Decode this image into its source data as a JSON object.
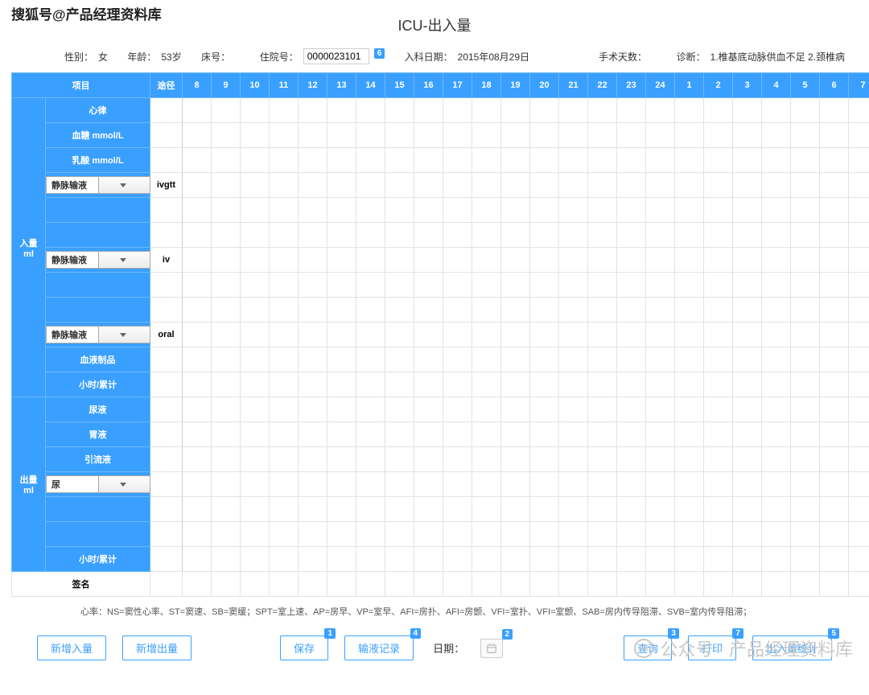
{
  "watermarks": {
    "top": "搜狐号@产品经理资料库",
    "bottom": "公众号 · 产品经理资料库"
  },
  "title": "ICU-出入量",
  "info": {
    "sex_label": "性别：",
    "sex_value": "女",
    "age_label": "年龄：",
    "age_value": "53岁",
    "bed_label": "床号：",
    "adm_label": "住院号：",
    "adm_value": "0000023101",
    "adm_badge": "6",
    "indate_label": "入科日期：",
    "indate_value": "2015年08月29日",
    "surgdays_label": "手术天数：",
    "diag_label": "诊断：",
    "diag_value": "1.椎基底动脉供血不足 2.颈椎病"
  },
  "columns": {
    "item": "项目",
    "route": "途径",
    "hours": [
      "8",
      "9",
      "10",
      "11",
      "12",
      "13",
      "14",
      "15",
      "16",
      "17",
      "18",
      "19",
      "20",
      "21",
      "22",
      "23",
      "24",
      "1",
      "2",
      "3",
      "4",
      "5",
      "6",
      "7"
    ]
  },
  "intake": {
    "group": "入量\nml",
    "rows": {
      "hr": "心律",
      "glucose": "血糖 mmol/L",
      "lactate": "乳酸 mmol/L",
      "blood": "血液制品",
      "subtotal": "小时/累计"
    },
    "select_label": "静脉输液",
    "routes": {
      "r1": "ivgtt",
      "r2": "iv",
      "r3": "oral"
    }
  },
  "output": {
    "group": "出量\nml",
    "rows": {
      "urine": "尿液",
      "gastric": "胃液",
      "drain": "引流液",
      "subtotal": "小时/累计"
    },
    "select_label": "尿"
  },
  "signature": "签名",
  "footnote": "心率：NS=窦性心率、ST=窦速、SB=窦缓；SPT=室上速、AP=房早、VP=室早、AFI=房扑、AFI=房颤、VFI=室扑、VFI=室颤、SAB=房内传导阻滞、SVB=室内传导阻滞；",
  "buttons": {
    "add_in": "新增入量",
    "add_out": "新增出量",
    "save": "保存",
    "infusion": "输液记录",
    "date_label": "日期：",
    "query": "查询",
    "print": "打印",
    "stats": "出入量统计",
    "badges": {
      "save": "1",
      "infusion": "4",
      "date": "2",
      "query": "3",
      "print": "7",
      "stats": "5"
    }
  }
}
